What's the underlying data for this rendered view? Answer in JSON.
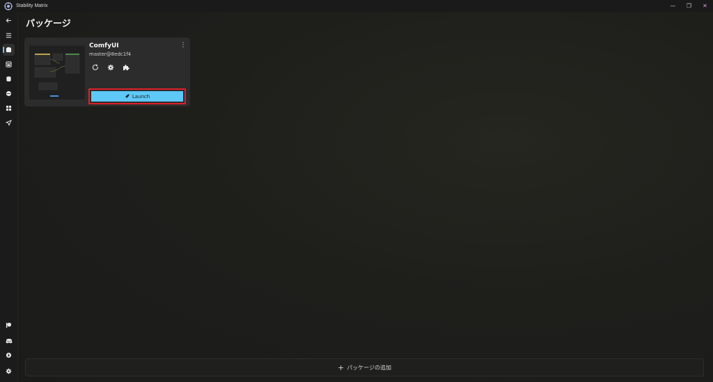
{
  "window": {
    "title": "Stability Matrix",
    "controls": {
      "minimize": "—",
      "restore": "❐",
      "close": "✕"
    }
  },
  "page": {
    "title": "パッケージ"
  },
  "package_card": {
    "name": "ComfyUI",
    "version": "master@8edc1f4",
    "menu_glyph": "⋮",
    "launch_label": "Launch",
    "actions": [
      "refresh-icon",
      "gear-icon",
      "puzzle-icon"
    ]
  },
  "footer": {
    "add_label": "パッケージの追加",
    "add_glyph": "+"
  },
  "sidebar": {
    "items": [
      "back-arrow-icon",
      "hamburger-menu-icon",
      "packages-icon",
      "inference-icon",
      "checkpoints-icon",
      "model-browser-icon",
      "workflows-icon",
      "share-icon",
      "patreon-icon",
      "discord-icon",
      "download-icon",
      "settings-icon"
    ],
    "selected": "packages-icon"
  },
  "colors": {
    "accent": "#5ec8f7",
    "highlight_outline": "#e0202a",
    "background": "#1c1c1b",
    "card": "#2c2c2c"
  }
}
